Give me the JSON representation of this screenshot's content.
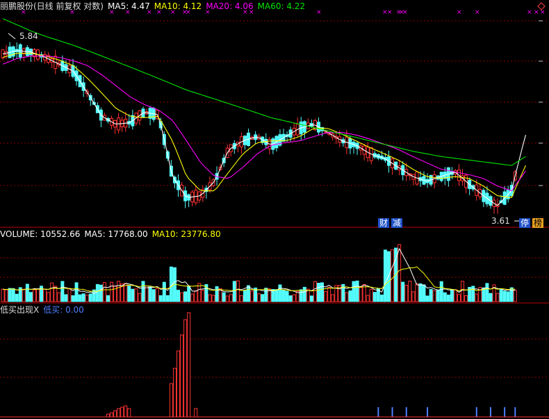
{
  "main_panel": {
    "title": "丽鹏股份(日线 前复权 对数)",
    "ma5": "MA5: 4.47",
    "ma10": "MA10: 4.12",
    "ma20": "MA20: 4.06",
    "ma60": "MA60: 4.22",
    "high_label": "5.84",
    "low_label": "3.61",
    "tags": {
      "cai": "财",
      "jian": "减",
      "ting": "停",
      "bang": "榜"
    }
  },
  "volume_panel": {
    "volume": "VOLUME: 10552.66",
    "ma5": "MA5: 17768.00",
    "ma10": "MA10: 23776.80"
  },
  "indicator_panel": {
    "title": "低买出现X",
    "value": "低买: 0.00"
  },
  "colors": {
    "up": "#ff3232",
    "down": "#54fcfc",
    "ma5": "#ffffff",
    "ma10": "#ffff00",
    "ma20": "#ff00ff",
    "ma60": "#00e600",
    "grid": "#8b0000",
    "indicator": "#4f7fff"
  },
  "chart_data": [
    {
      "type": "candlestick",
      "price_range": [
        3.5,
        6.2
      ],
      "high": 5.84,
      "low": 3.61,
      "series": [
        {
          "name": "MA5",
          "values": [
            5.55,
            5.6,
            5.58,
            5.5,
            5.4,
            5.3,
            5.0,
            4.7,
            4.6,
            4.62,
            4.75,
            4.72,
            4.0,
            3.78,
            3.8,
            3.95,
            4.3,
            4.4,
            4.45,
            4.35,
            4.45,
            4.55,
            4.6,
            4.5,
            4.4,
            4.35,
            4.25,
            4.2,
            4.1,
            4.0,
            3.95,
            4.0,
            4.05,
            3.92,
            3.8,
            3.7,
            3.85,
            4.47
          ]
        },
        {
          "name": "MA10",
          "values": [
            5.5,
            5.56,
            5.56,
            5.52,
            5.46,
            5.38,
            5.2,
            5.0,
            4.8,
            4.7,
            4.68,
            4.7,
            4.4,
            4.0,
            3.85,
            3.85,
            4.05,
            4.25,
            4.38,
            4.4,
            4.4,
            4.45,
            4.55,
            4.55,
            4.48,
            4.4,
            4.32,
            4.25,
            4.18,
            4.08,
            4.0,
            3.98,
            4.0,
            3.98,
            3.9,
            3.8,
            3.78,
            4.12
          ]
        },
        {
          "name": "MA20",
          "values": [
            5.4,
            5.48,
            5.52,
            5.52,
            5.5,
            5.45,
            5.38,
            5.25,
            5.1,
            4.95,
            4.85,
            4.78,
            4.65,
            4.4,
            4.15,
            4.0,
            3.98,
            4.1,
            4.25,
            4.35,
            4.38,
            4.4,
            4.45,
            4.5,
            4.5,
            4.47,
            4.42,
            4.36,
            4.3,
            4.22,
            4.15,
            4.08,
            4.05,
            4.02,
            3.98,
            3.9,
            3.85,
            4.06
          ]
        },
        {
          "name": "MA60",
          "values": [
            6.1,
            6.0,
            5.9,
            5.82,
            5.75,
            5.68,
            5.6,
            5.52,
            5.44,
            5.36,
            5.28,
            5.2,
            5.12,
            5.04,
            4.98,
            4.92,
            4.86,
            4.8,
            4.74,
            4.68,
            4.64,
            4.6,
            4.56,
            4.52,
            4.48,
            4.44,
            4.4,
            4.36,
            4.32,
            4.28,
            4.25,
            4.22,
            4.2,
            4.18,
            4.16,
            4.14,
            4.12,
            4.22
          ]
        }
      ]
    },
    {
      "type": "bar",
      "name": "VOLUME",
      "value": 10552.66,
      "ma5": 17768.0,
      "ma10": 23776.8
    },
    {
      "type": "bar",
      "name": "低买出现X",
      "value": 0.0
    }
  ]
}
